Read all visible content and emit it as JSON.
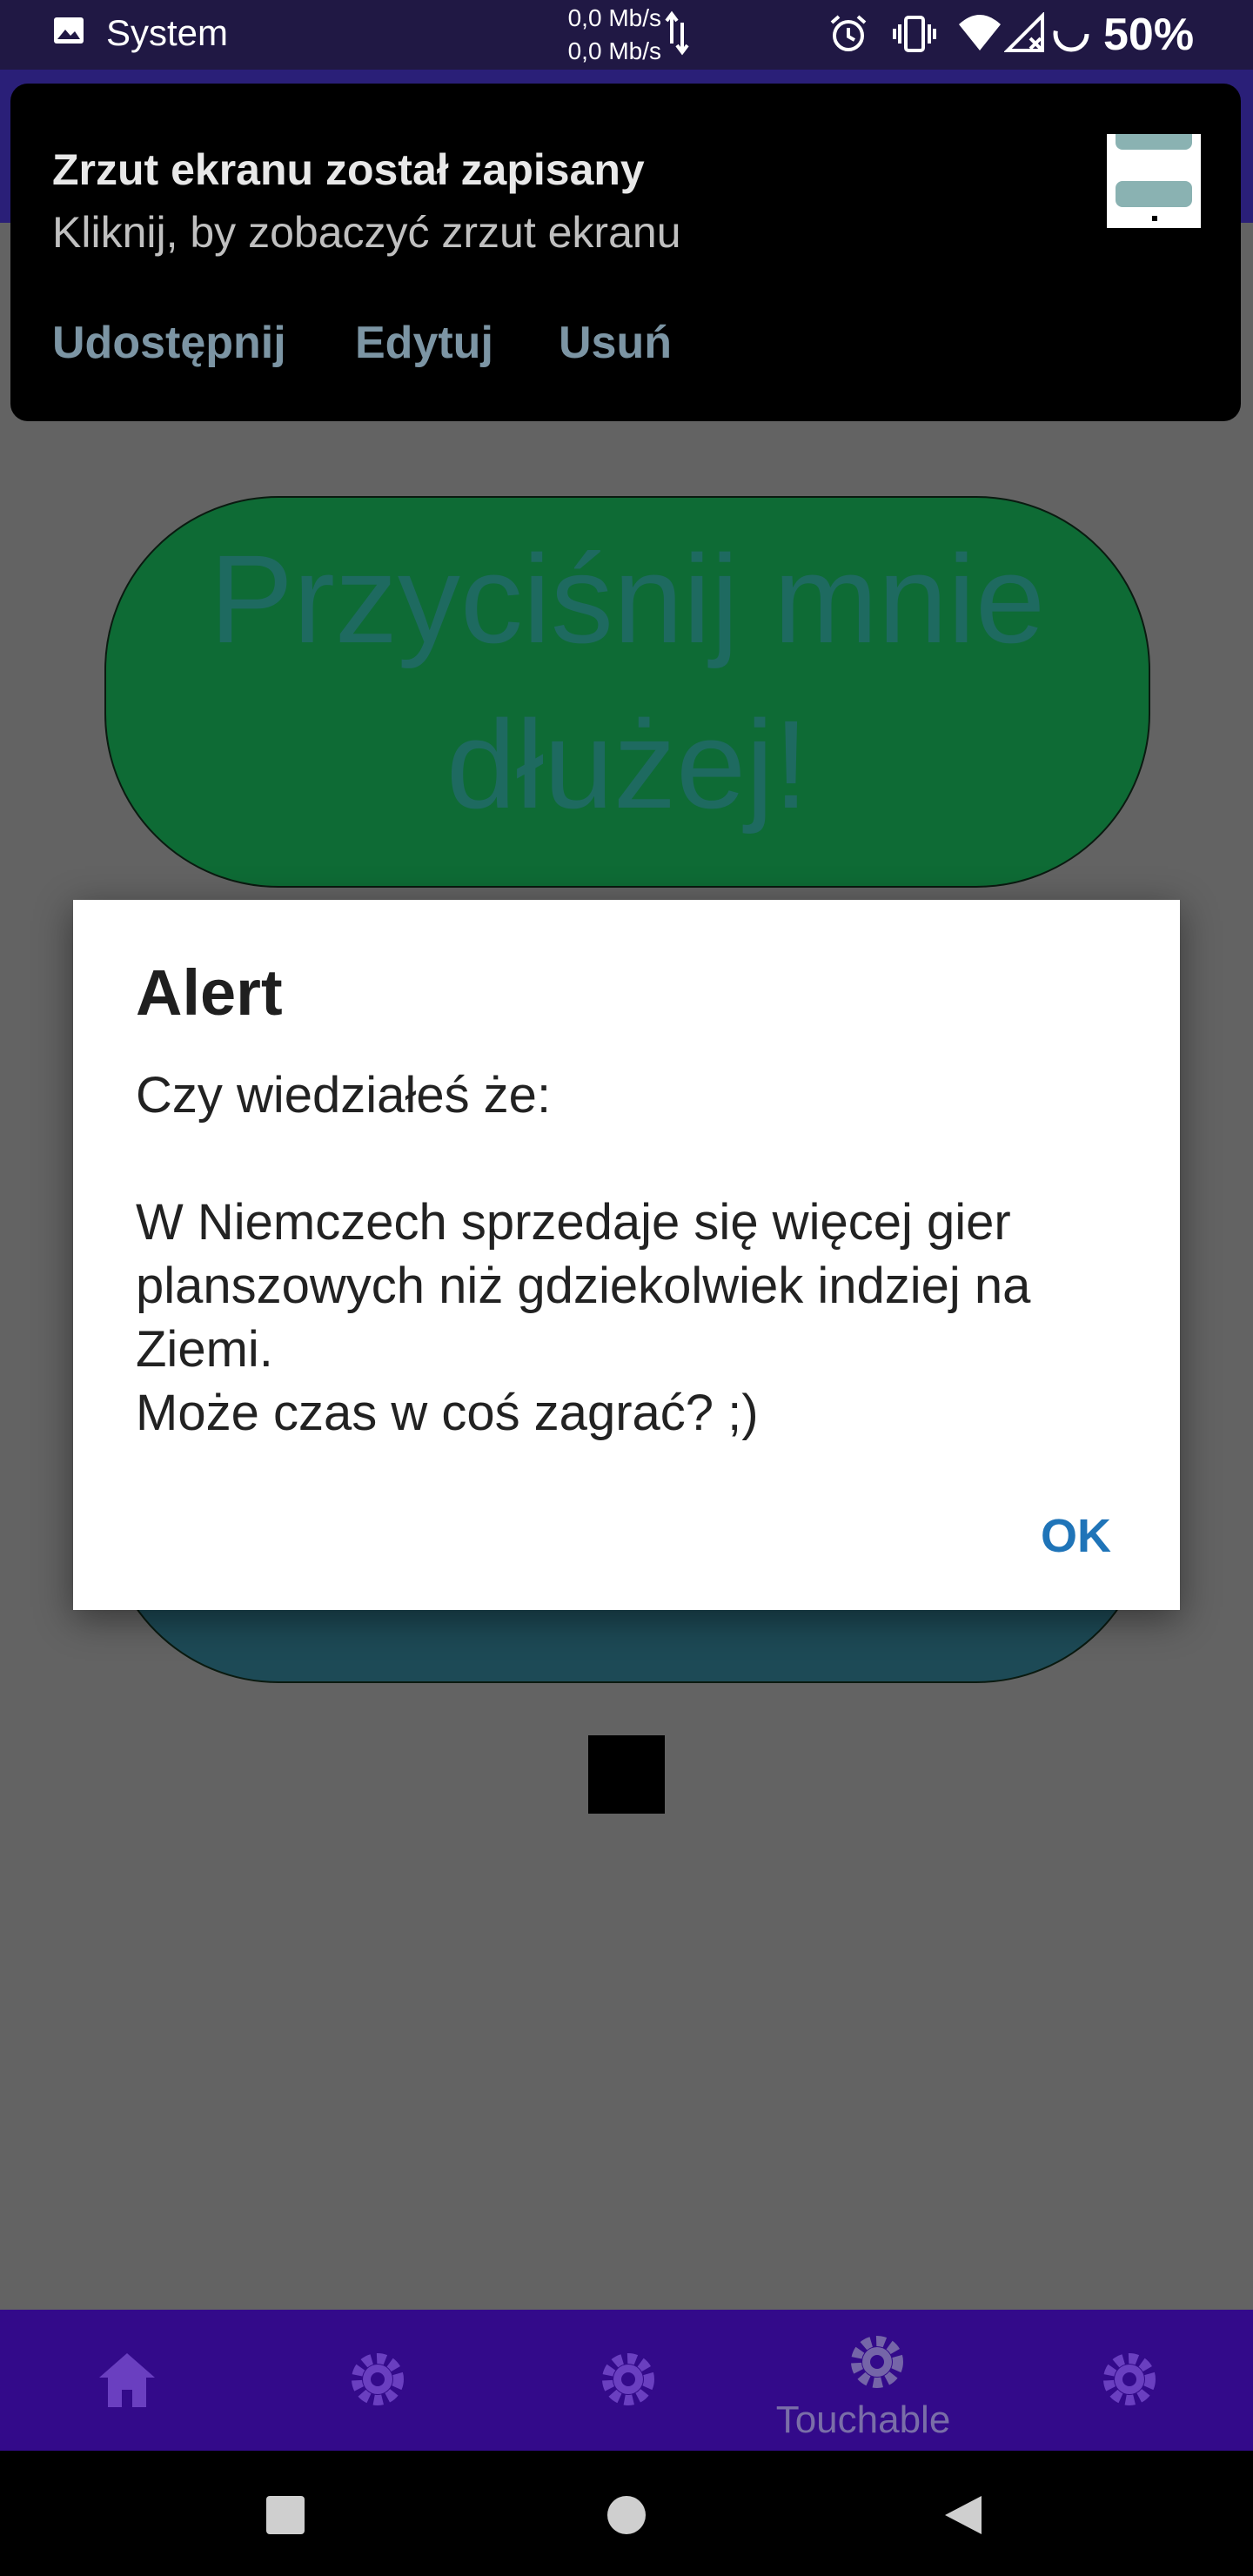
{
  "status_bar": {
    "app_name": "System",
    "net_up": "0,0 Mb/s",
    "net_down": "0,0 Mb/s",
    "battery": "50%"
  },
  "notification": {
    "title": "Zrzut ekranu został zapisany",
    "subtitle": "Kliknij, by zobaczyć zrzut ekranu",
    "actions": [
      "Udostępnij",
      "Edytuj",
      "Usuń"
    ]
  },
  "main": {
    "press_longer_label": "Przyciśnij mnie dłużej!"
  },
  "dialog": {
    "title": "Alert",
    "body": "Czy wiedziałeś że:\n\n W Niemczech sprzedaje się więcej gier planszowych niż gdziekolwiek indziej na Ziemi.\n Może czas w coś zagrać? ;)",
    "ok_label": "OK"
  },
  "tab_bar": {
    "tabs": [
      {
        "icon": "home-icon",
        "label": ""
      },
      {
        "icon": "gear-icon",
        "label": ""
      },
      {
        "icon": "gear-icon",
        "label": ""
      },
      {
        "icon": "gear-icon",
        "label": "Touchable"
      },
      {
        "icon": "gear-icon",
        "label": ""
      }
    ]
  },
  "colors": {
    "scrim": "#636363",
    "tab_bar": "#330a8a",
    "accent_ok": "#1f74b8",
    "green_button": "#0e6b35"
  }
}
